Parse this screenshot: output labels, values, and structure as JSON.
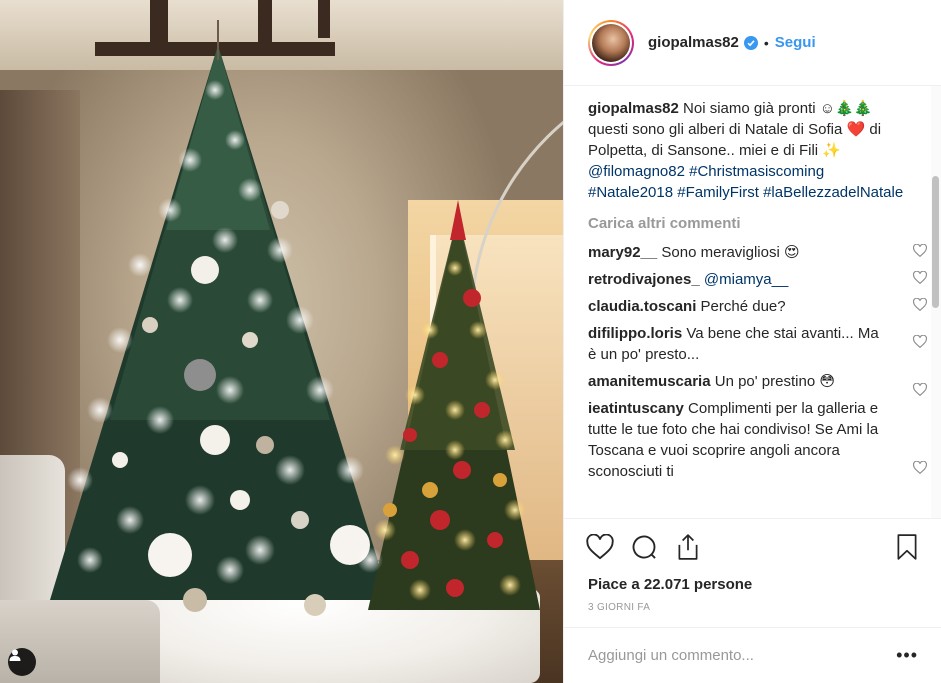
{
  "post": {
    "user": {
      "username": "giopalmas82",
      "separator": "•",
      "follow_label": "Segui",
      "avatar_icon": "profile-photo",
      "verified_icon": "verified-badge-icon",
      "accent": "#3897f0"
    },
    "caption": {
      "username": "giopalmas82",
      "text_1": "Noi siamo già pronti ☺🎄🎄 questi sono gli alberi di Natale di Sofia ",
      "heart": "❤️",
      "text_2": " di Polpetta, di Sansone.. miei e di Fili ✨ ",
      "mention": "@filomagno82",
      "hashtag_1": "#Christmasiscoming",
      "hashtag_2": "#Natale2018",
      "hashtag_3": "#FamilyFirst",
      "hashtag_4": "#laBellezzadelNatale"
    },
    "load_more_label": "Carica altri commenti",
    "comments": [
      {
        "username": "mary92__",
        "text": "Sono meravigliosi 😍",
        "mention": ""
      },
      {
        "username": "retrodivajones_",
        "text": "",
        "mention": "@miamya__"
      },
      {
        "username": "claudia.toscani",
        "text": "Perché due?",
        "mention": ""
      },
      {
        "username": "difilippo.loris",
        "text": "Va bene che stai avanti... Ma è un po' presto...",
        "mention": ""
      },
      {
        "username": "amanitemuscaria",
        "text": "Un po' prestino 😳",
        "mention": ""
      },
      {
        "username": "ieatintuscany",
        "text": "Complimenti per la galleria e tutte le tue foto che hai condiviso! Se Ami la Toscana e vuoi scoprire angoli ancora sconosciuti ti",
        "mention": ""
      }
    ],
    "likes_label": "Piace a 22.071 persone",
    "date_label": "3 GIORNI FA",
    "add_comment_placeholder": "Aggiungi un commento...",
    "more_options_label": "•••",
    "icons": {
      "like": "heart-icon",
      "comment": "comment-bubble-icon",
      "share": "share-icon",
      "save": "bookmark-icon",
      "comment_like": "small-heart-icon",
      "user_tag": "user-tag-icon"
    }
  }
}
